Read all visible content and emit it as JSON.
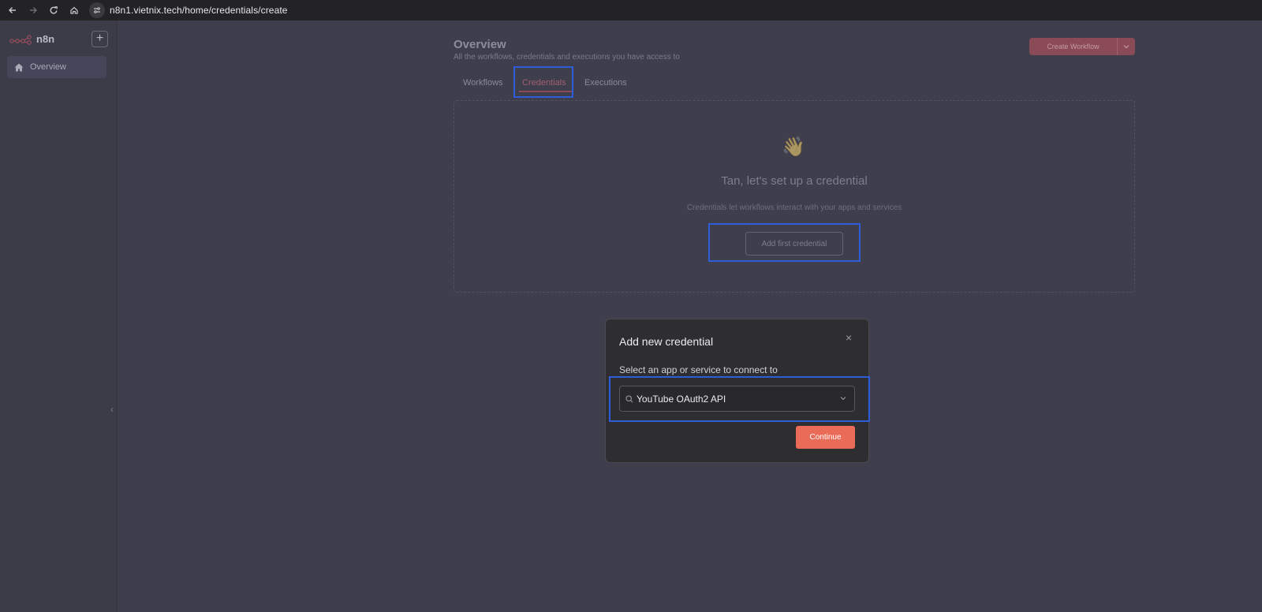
{
  "browser": {
    "url": "n8n1.vietnix.tech/home/credentials/create",
    "icons": [
      "back-icon",
      "forward-icon",
      "reload-icon",
      "home-icon",
      "site-info-icon"
    ]
  },
  "sidebar": {
    "logo_text": "n8n",
    "add_label": "+",
    "items": [
      {
        "label": "Overview",
        "icon": "home-icon"
      }
    ],
    "collapse_glyph": "‹"
  },
  "main": {
    "title": "Overview",
    "subtitle": "All the workflows, credentials and executions you have access to",
    "create_button_label": "Create Workflow",
    "tabs": [
      {
        "label": "Workflows"
      },
      {
        "label": "Credentials",
        "active": true
      },
      {
        "label": "Executions"
      }
    ],
    "empty_state": {
      "emoji": "👋",
      "heading": "Tan, let's set up a credential",
      "description": "Credentials let workflows interact with your apps and services",
      "button_label": "Add first credential"
    }
  },
  "modal": {
    "title": "Add new credential",
    "close_glyph": "×",
    "label": "Select an app or service to connect to",
    "select_value": "YouTube OAuth2 API",
    "continue_label": "Continue"
  },
  "colors": {
    "accent": "#ea6b57",
    "highlight": "#2f5cd8",
    "background": "#3f3e4d"
  }
}
